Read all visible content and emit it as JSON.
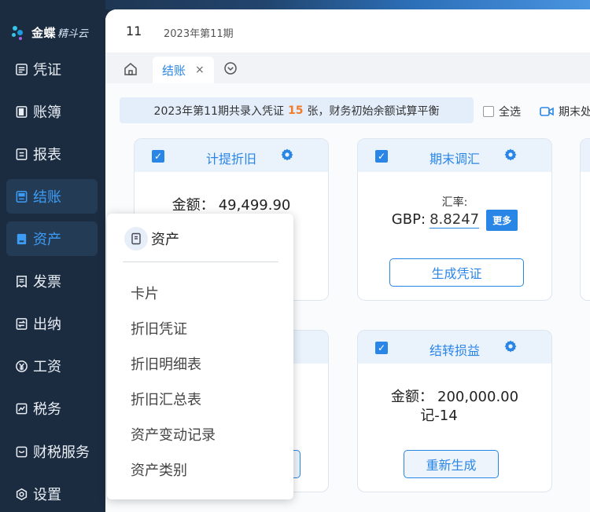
{
  "app": {
    "logo_text": "金蝶",
    "logo_sub": "精斗云"
  },
  "sidebar": {
    "items": [
      {
        "label": "凭证",
        "icon": "list-icon"
      },
      {
        "label": "账簿",
        "icon": "book-icon"
      },
      {
        "label": "报表",
        "icon": "report-icon"
      },
      {
        "label": "结账",
        "icon": "checkout-icon",
        "state": "active"
      },
      {
        "label": "资产",
        "icon": "asset-icon",
        "state": "hover"
      },
      {
        "label": "发票",
        "icon": "invoice-icon"
      },
      {
        "label": "出纳",
        "icon": "cashier-icon"
      },
      {
        "label": "工资",
        "icon": "salary-icon"
      },
      {
        "label": "税务",
        "icon": "tax-icon"
      },
      {
        "label": "财税服务",
        "icon": "service-icon"
      },
      {
        "label": "设置",
        "icon": "settings-icon"
      }
    ]
  },
  "header": {
    "period_num": "11",
    "period_text": "2023年第11期"
  },
  "tabs": {
    "active": {
      "label": "结账",
      "close": "×"
    }
  },
  "summary": {
    "prefix": "2023年第11期共录入凭证",
    "count": "15",
    "suffix": "张，财务初始余额试算平衡"
  },
  "toolbar": {
    "select_all": "全选",
    "period_end": "期末处"
  },
  "cards": {
    "depreciation": {
      "title": "计提折旧",
      "amount_label": "金额：",
      "amount": "49,499.90"
    },
    "fx": {
      "title": "期末调汇",
      "rate_label": "汇率:",
      "currency": "GBP:",
      "rate": "8.8247",
      "more": "更多",
      "button": "生成凭证"
    },
    "profit": {
      "title": "结转损益",
      "amount_label": "金额：",
      "amount": "200,000.00",
      "voucher": "记-14",
      "button": "重新生成"
    }
  },
  "dropdown": {
    "title": "资产",
    "items": [
      "卡片",
      "折旧凭证",
      "折旧明细表",
      "折旧汇总表",
      "资产变动记录",
      "资产类别"
    ]
  },
  "colors": {
    "accent": "#2a86e6",
    "sidebar_bg": "#1c2c40",
    "highlight": "#f07c2a"
  }
}
